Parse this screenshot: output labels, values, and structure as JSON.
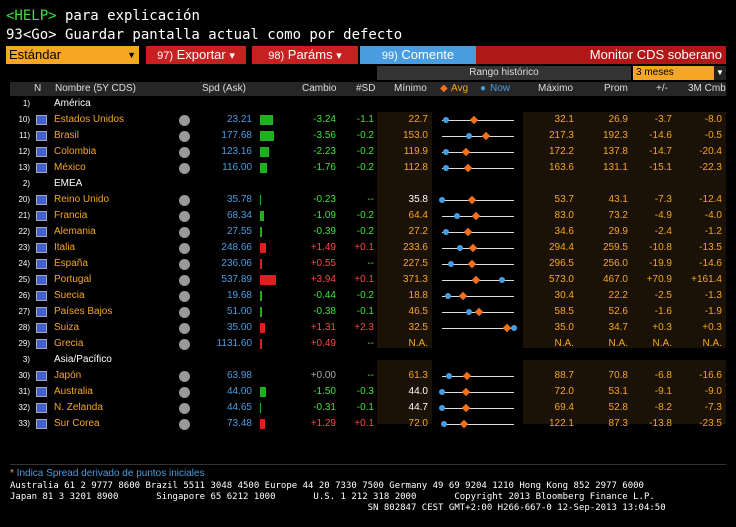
{
  "command": {
    "help_key": "<HELP>",
    "help_text": " para explicación",
    "go_line": "93<Go> Guardar pantalla actual como por defecto"
  },
  "toolbar": {
    "preset": "Estándar",
    "export_num": "97)",
    "export_label": "Exportar",
    "params_num": "98)",
    "params_label": "Paráms",
    "comment_num": "99)",
    "comment_label": "Comente",
    "title": "Monitor CDS soberano"
  },
  "range": {
    "label": "Rango histórico",
    "selected": "3 meses"
  },
  "header": {
    "n": "N",
    "name": "Nombre (5Y CDS)",
    "spd": "Spd (Ask)",
    "chg": "Cambio",
    "sd": "#SD",
    "min": "Mínimo",
    "avg": "Avg",
    "now": "Now",
    "max": "Máximo",
    "avg2": "Prom",
    "pm": "+/-",
    "m3": "3M Cmb"
  },
  "groups": [
    {
      "num": "1)",
      "name": "América",
      "rows": [
        {
          "n": "10)",
          "name": "Estados Unidos",
          "spd": "23.21",
          "chg": "-3.24",
          "sd": "-1.1",
          "min": "22.7",
          "max": "32.1",
          "avg": "26.9",
          "pm": "-3.7",
          "m3": "-8.0",
          "bar": -3.24,
          "now_pos": 0.05,
          "avg_pos": 0.45
        },
        {
          "n": "11)",
          "name": "Brasil",
          "spd": "177.68",
          "chg": "-3.56",
          "sd": "-0.2",
          "min": "153.0",
          "max": "217.3",
          "avg": "192.3",
          "pm": "-14.6",
          "m3": "-0.5",
          "bar": -3.56,
          "now_pos": 0.38,
          "avg_pos": 0.61
        },
        {
          "n": "12)",
          "name": "Colombia",
          "spd": "123.16",
          "chg": "-2.23",
          "sd": "-0.2",
          "min": "119.9",
          "max": "172.2",
          "avg": "137.8",
          "pm": "-14.7",
          "m3": "-20.4",
          "bar": -2.23,
          "now_pos": 0.06,
          "avg_pos": 0.34
        },
        {
          "n": "13)",
          "name": "México",
          "spd": "116.00",
          "chg": "-1.76",
          "sd": "-0.2",
          "min": "112.8",
          "max": "163.6",
          "avg": "131.1",
          "pm": "-15.1",
          "m3": "-22.3",
          "bar": -1.76,
          "now_pos": 0.06,
          "avg_pos": 0.36
        }
      ]
    },
    {
      "num": "2)",
      "name": "EMEA",
      "rows": [
        {
          "n": "20)",
          "name": "Reino Unido",
          "spd": "35.78",
          "chg": "-0.23",
          "sd": "--",
          "min": "35.8",
          "max": "53.7",
          "avg": "43.1",
          "pm": "-7.3",
          "m3": "-12.4",
          "bar": -0.23,
          "now_pos": 0.0,
          "avg_pos": 0.41
        },
        {
          "n": "21)",
          "name": "Francia",
          "spd": "68.34",
          "chg": "-1.09",
          "sd": "-0.2",
          "min": "64.4",
          "max": "83.0",
          "avg": "73.2",
          "pm": "-4.9",
          "m3": "-4.0",
          "bar": -1.09,
          "now_pos": 0.21,
          "avg_pos": 0.47
        },
        {
          "n": "22)",
          "name": "Alemania",
          "spd": "27.55",
          "chg": "-0.39",
          "sd": "-0.2",
          "min": "27.2",
          "max": "34.6",
          "avg": "29.9",
          "pm": "-2.4",
          "m3": "-1.2",
          "bar": -0.39,
          "now_pos": 0.05,
          "avg_pos": 0.36
        },
        {
          "n": "23)",
          "name": "Italia",
          "spd": "248.66",
          "chg": "+1.49",
          "sd": "+0.1",
          "min": "233.6",
          "max": "294.4",
          "avg": "259.5",
          "pm": "-10.8",
          "m3": "-13.5",
          "bar": 1.49,
          "now_pos": 0.25,
          "avg_pos": 0.43
        },
        {
          "n": "24)",
          "name": "España",
          "spd": "236.06",
          "chg": "+0.55",
          "sd": "--",
          "min": "227.5",
          "max": "296.5",
          "avg": "256.0",
          "pm": "-19.9",
          "m3": "-14.6",
          "bar": 0.55,
          "now_pos": 0.12,
          "avg_pos": 0.41
        },
        {
          "n": "25)",
          "name": "Portugal",
          "spd": "537.89",
          "chg": "+3.94",
          "sd": "+0.1",
          "min": "371.3",
          "max": "573.0",
          "avg": "467.0",
          "pm": "+70.9",
          "m3": "+161.4",
          "bar": 3.94,
          "now_pos": 0.83,
          "avg_pos": 0.47
        },
        {
          "n": "26)",
          "name": "Suecia",
          "spd": "19.68",
          "chg": "-0.44",
          "sd": "-0.2",
          "min": "18.8",
          "max": "30.4",
          "avg": "22.2",
          "pm": "-2.5",
          "m3": "-1.3",
          "bar": -0.44,
          "now_pos": 0.08,
          "avg_pos": 0.29
        },
        {
          "n": "27)",
          "name": "Países Bajos",
          "spd": "51.00",
          "chg": "-0.38",
          "sd": "-0.1",
          "min": "46.5",
          "max": "58.5",
          "avg": "52.6",
          "pm": "-1.6",
          "m3": "-1.9",
          "bar": -0.38,
          "now_pos": 0.38,
          "avg_pos": 0.51
        },
        {
          "n": "28)",
          "name": "Suiza",
          "spd": "35.00",
          "chg": "+1.31",
          "sd": "+2.3",
          "min": "32.5",
          "max": "35.0",
          "avg": "34.7",
          "pm": "+0.3",
          "m3": "+0.3",
          "bar": 1.31,
          "now_pos": 1.0,
          "avg_pos": 0.9
        },
        {
          "n": "29)",
          "name": "Grecia",
          "spd": "1131.60",
          "chg": "+0.49",
          "sd": "--",
          "min": "N.A.",
          "max": "N.A.",
          "avg": "N.A.",
          "pm": "N.A.",
          "m3": "N.A.",
          "bar": 0.49,
          "now_pos": null,
          "avg_pos": null
        }
      ]
    },
    {
      "num": "3)",
      "name": "Asia/Pacífico",
      "rows": [
        {
          "n": "30)",
          "name": "Japón",
          "spd": "63.98",
          "chg": "+0.00",
          "sd": "--",
          "min": "61.3",
          "max": "88.7",
          "avg": "70.8",
          "pm": "-6.8",
          "m3": "-16.6",
          "bar": 0,
          "now_pos": 0.1,
          "avg_pos": 0.35
        },
        {
          "n": "31)",
          "name": "Australia",
          "spd": "44.00",
          "chg": "-1.50",
          "sd": "-0.3",
          "min": "44.0",
          "max": "72.0",
          "avg": "53.1",
          "pm": "-9.1",
          "m3": "-9.0",
          "bar": -1.5,
          "now_pos": 0.0,
          "avg_pos": 0.33
        },
        {
          "n": "32)",
          "name": "N. Zelanda",
          "spd": "44.65",
          "chg": "-0.31",
          "sd": "-0.1",
          "min": "44.7",
          "max": "69.4",
          "avg": "52.8",
          "pm": "-8.2",
          "m3": "-7.3",
          "bar": -0.31,
          "now_pos": 0.0,
          "avg_pos": 0.33
        },
        {
          "n": "33)",
          "name": "Sur Corea",
          "spd": "73.48",
          "chg": "+1.29",
          "sd": "+0.1",
          "min": "72.0",
          "max": "122.1",
          "avg": "87.3",
          "pm": "-13.8",
          "m3": "-23.5",
          "bar": 1.29,
          "now_pos": 0.03,
          "avg_pos": 0.31
        }
      ]
    }
  ],
  "footnote": {
    "star": "*",
    "text": " Indica Spread derivado de puntos iniciales"
  },
  "contacts": "Australia 61 2 9777 8600 Brazil 5511 3048 4500 Europe 44 20 7330 7500 Germany 49 69 9204 1210 Hong Kong 852 2977 6000\nJapan 81 3 3201 8900       Singapore 65 6212 1000       U.S. 1 212 318 2000       Copyright 2013 Bloomberg Finance L.P.\n                                                                  SN 802847 CEST GMT+2:00 H266-667-0 12-Sep-2013 13:04:50",
  "colors": {
    "accent": "#f5a623",
    "up": "#3fe03f",
    "down": "#ff4444",
    "now": "#4a9ce0",
    "avg": "#f07020"
  }
}
